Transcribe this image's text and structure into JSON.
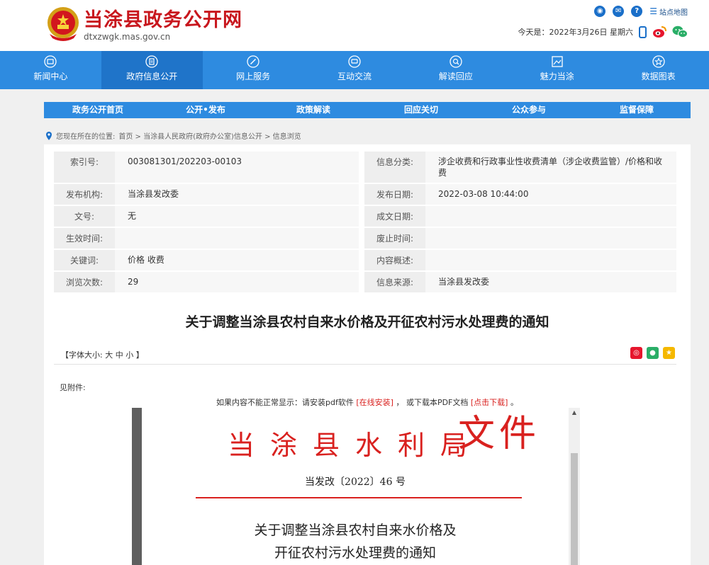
{
  "header": {
    "site_title": "当涂县政务公开网",
    "site_domain": "dtxzwgk.mas.gov.cn",
    "sitemap_label": "站点地图",
    "date_text": "今天是：2022年3月26日 星期六"
  },
  "nav": {
    "items": [
      {
        "label": "新闻中心",
        "icon": "news-icon"
      },
      {
        "label": "政府信息公开",
        "icon": "document-icon"
      },
      {
        "label": "网上服务",
        "icon": "compass-icon"
      },
      {
        "label": "互动交流",
        "icon": "chat-icon"
      },
      {
        "label": "解读回应",
        "icon": "search-icon"
      },
      {
        "label": "魅力当涂",
        "icon": "image-icon"
      },
      {
        "label": "数据图表",
        "icon": "star-icon"
      }
    ],
    "active_index": 1
  },
  "subnav": {
    "items": [
      "政务公开首页",
      "公开•发布",
      "政策解读",
      "回应关切",
      "公众参与",
      "监督保障"
    ]
  },
  "breadcrumb": {
    "prefix": "您现在所在的位置:",
    "path": "首页 > 当涂县人民政府(政府办公室)信息公开 > 信息浏览"
  },
  "meta": {
    "rows": [
      {
        "label1": "索引号:",
        "value1": "003081301/202203-00103",
        "label2": "信息分类:",
        "value2": "涉企收费和行政事业性收费清单（涉企收费监管）/价格和收费"
      },
      {
        "label1": "发布机构:",
        "value1": "当涂县发改委",
        "label2": "发布日期:",
        "value2": "2022-03-08 10:44:00"
      },
      {
        "label1": "文号:",
        "value1": "无",
        "label2": "成文日期:",
        "value2": ""
      },
      {
        "label1": "生效时间:",
        "value1": "",
        "label2": "废止时间:",
        "value2": ""
      },
      {
        "label1": "关键词:",
        "value1": "价格 收费",
        "label2": "内容概述:",
        "value2": ""
      },
      {
        "label1": "浏览次数:",
        "value1": "29",
        "label2": "信息来源:",
        "value2": "当涂县发改委"
      }
    ]
  },
  "article": {
    "title": "关于调整当涂县农村自来水价格及开征农村污水处理费的通知",
    "font_size_prefix": "【字体大小:",
    "font_large": "大",
    "font_medium": "中",
    "font_small": "小",
    "font_size_suffix": "】",
    "attachment_label": "见附件:",
    "pdf_note_prefix": "如果内容不能正常显示：请安装pdf软件",
    "pdf_install_link": "[在线安装]",
    "pdf_note_middle": "， 或下载本PDF文档",
    "pdf_download_link": "[点击下载]",
    "pdf_note_suffix": "。"
  },
  "pdf_page": {
    "agency_head": "当涂县水利局",
    "wen": "文件",
    "doc_number": "当发改〔2022〕46 号",
    "title_line1": "关于调整当涂县农村自来水价格及",
    "title_line2": "开征农村污水处理费的通知"
  },
  "colors": {
    "brand_red": "#c8161d",
    "nav_blue": "#2e8be0",
    "nav_active": "#1f74c9",
    "link_red": "#d9211f"
  }
}
